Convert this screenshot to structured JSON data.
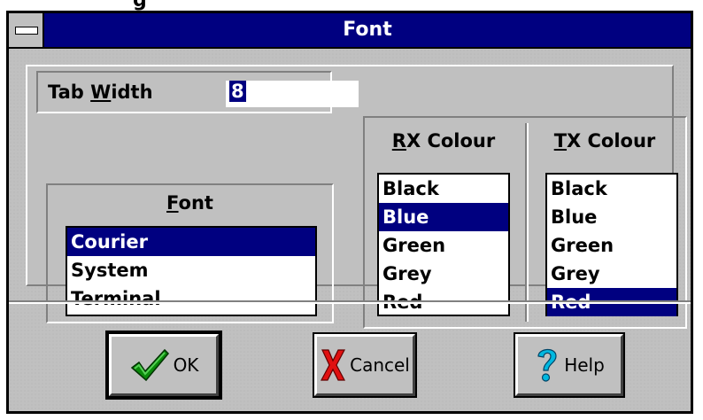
{
  "top_fragment": "g",
  "window": {
    "title": "Font"
  },
  "tab_width": {
    "label": "Tab Width",
    "underline": "W",
    "value": "8"
  },
  "font_group": {
    "title": "Font",
    "underline": "F",
    "items": [
      "Courier",
      "System",
      "Terminal"
    ],
    "selected": "Courier"
  },
  "rx_colour": {
    "title": "RX Colour",
    "underline": "R",
    "items": [
      "Black",
      "Blue",
      "Green",
      "Grey",
      "Red"
    ],
    "selected": "Blue"
  },
  "tx_colour": {
    "title": "TX Colour",
    "underline": "T",
    "items": [
      "Black",
      "Blue",
      "Green",
      "Grey",
      "Red"
    ],
    "selected": "Red"
  },
  "buttons": {
    "ok": {
      "label": "OK",
      "icon": "checkmark-icon"
    },
    "cancel": {
      "label": "Cancel",
      "icon": "red-x-icon"
    },
    "help": {
      "label": "Help",
      "icon": "question-mark-icon"
    }
  },
  "colors": {
    "titlebar": "#000080",
    "selection": "#000080",
    "face": "#c0c0c0",
    "check_green": "#0a8a0a",
    "cancel_red": "#e01010",
    "help_cyan": "#00b8e0"
  }
}
